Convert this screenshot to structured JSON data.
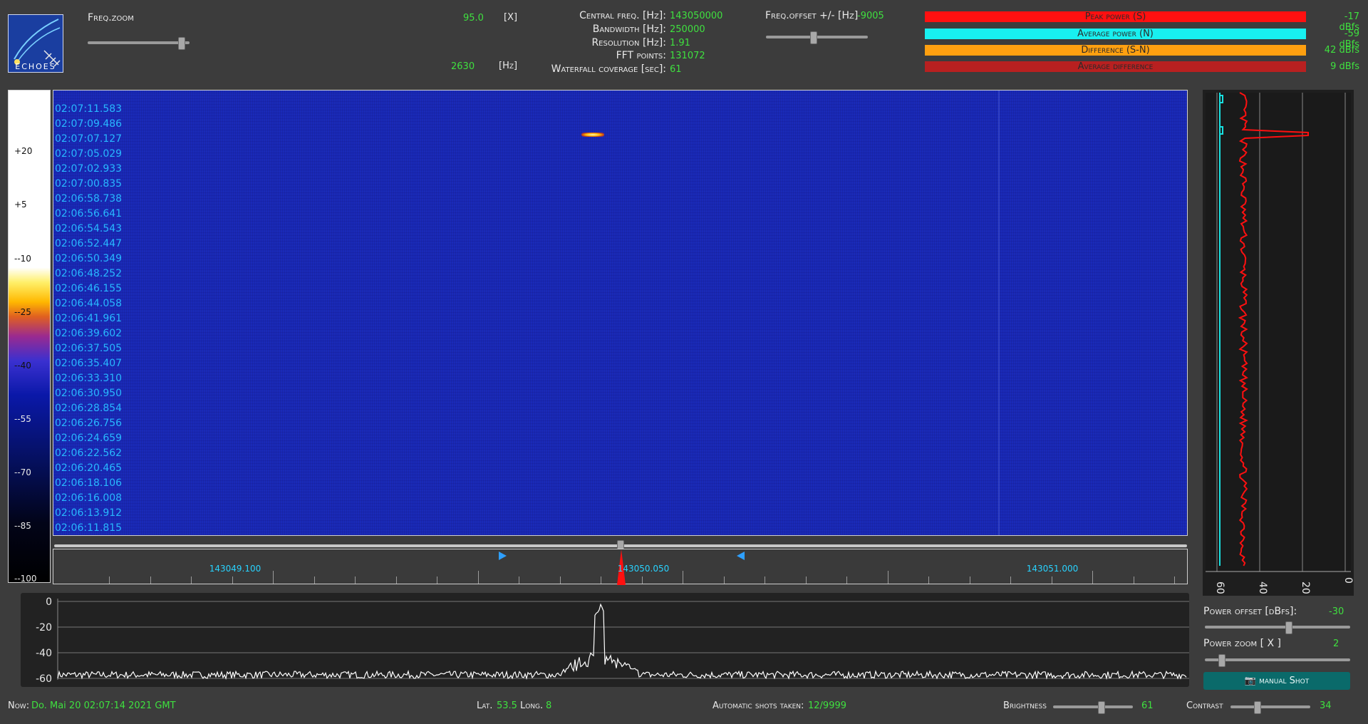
{
  "header": {
    "logo_text": "ECHOES",
    "freq_zoom": {
      "label": "Freq.zoom",
      "value": "95.0",
      "unit": "[X]",
      "hz_value": "2630",
      "hz_unit": "[Hz]",
      "slider_fraction": 0.92
    },
    "params": [
      {
        "label": "Central freq. [Hz]:",
        "value": "143050000"
      },
      {
        "label": "Bandwidth [Hz]:",
        "value": "250000"
      },
      {
        "label": "Resolution [Hz]:",
        "value": "1.91"
      },
      {
        "label": "FFT points:",
        "value": "131072"
      },
      {
        "label": "Waterfall coverage [sec]:",
        "value": "61"
      }
    ],
    "freq_offset": {
      "label": "Freq.offset +/- [Hz]",
      "value": "-9005",
      "slider_fraction": 0.47
    }
  },
  "bars": [
    {
      "label": "Peak power (S)",
      "value": "-17 dBfs",
      "color": "#ff1010"
    },
    {
      "label": "Average power (N)",
      "value": "-59 dBfs",
      "color": "#18f0f0"
    },
    {
      "label": "Difference (S-N)",
      "value": "42 dBfs",
      "color": "#ffa010"
    },
    {
      "label": "Average difference",
      "value": "9 dBfs",
      "color": "#b82020"
    }
  ],
  "scale_ticks": [
    "+20",
    "+5",
    "--10",
    "--25",
    "--40",
    "--55",
    "--70",
    "--85",
    "--100"
  ],
  "waterfall": {
    "timestamps": [
      "02:07:11.583",
      "02:07:09.486",
      "02:07:07.127",
      "02:07:05.029",
      "02:07:02.933",
      "02:07:00.835",
      "02:06:58.738",
      "02:06:56.641",
      "02:06:54.543",
      "02:06:52.447",
      "02:06:50.349",
      "02:06:48.252",
      "02:06:46.155",
      "02:06:44.058",
      "02:06:41.961",
      "02:06:39.602",
      "02:06:37.505",
      "02:06:35.407",
      "02:06:33.310",
      "02:06:30.950",
      "02:06:28.854",
      "02:06:26.756",
      "02:06:24.659",
      "02:06:22.562",
      "02:06:20.465",
      "02:06:18.106",
      "02:06:16.008",
      "02:06:13.912",
      "02:06:11.815"
    ]
  },
  "freq_scale": {
    "labels": [
      "143049.100",
      "143050.050",
      "143051.000"
    ]
  },
  "spectrum": {
    "y_ticks": [
      "0",
      "-20",
      "-40",
      "-60"
    ]
  },
  "power_graph": {
    "x_ticks": [
      "60",
      "40",
      "20",
      "0"
    ]
  },
  "controls": {
    "power_offset": {
      "label": "Power offset [dBfs]:",
      "value": "-30",
      "slider_fraction": 0.58
    },
    "power_zoom": {
      "label": "Power zoom [ X ]",
      "value": "2",
      "slider_fraction": 0.12
    },
    "manual_shot": "manual Shot"
  },
  "status": {
    "now_label": "Now:",
    "now_value": "Do. Mai 20 02:07:14 2021 GMT",
    "lat_label": "Lat.",
    "lat_value": "53.5",
    "long_label": "Long.",
    "long_value": "8",
    "shots_label": "Automatic shots taken:",
    "shots_value": "12/9999",
    "brightness_label": "Brightness",
    "brightness_value": "61",
    "brightness_fraction": 0.61,
    "contrast_label": "Contrast",
    "contrast_value": "34",
    "contrast_fraction": 0.34
  }
}
